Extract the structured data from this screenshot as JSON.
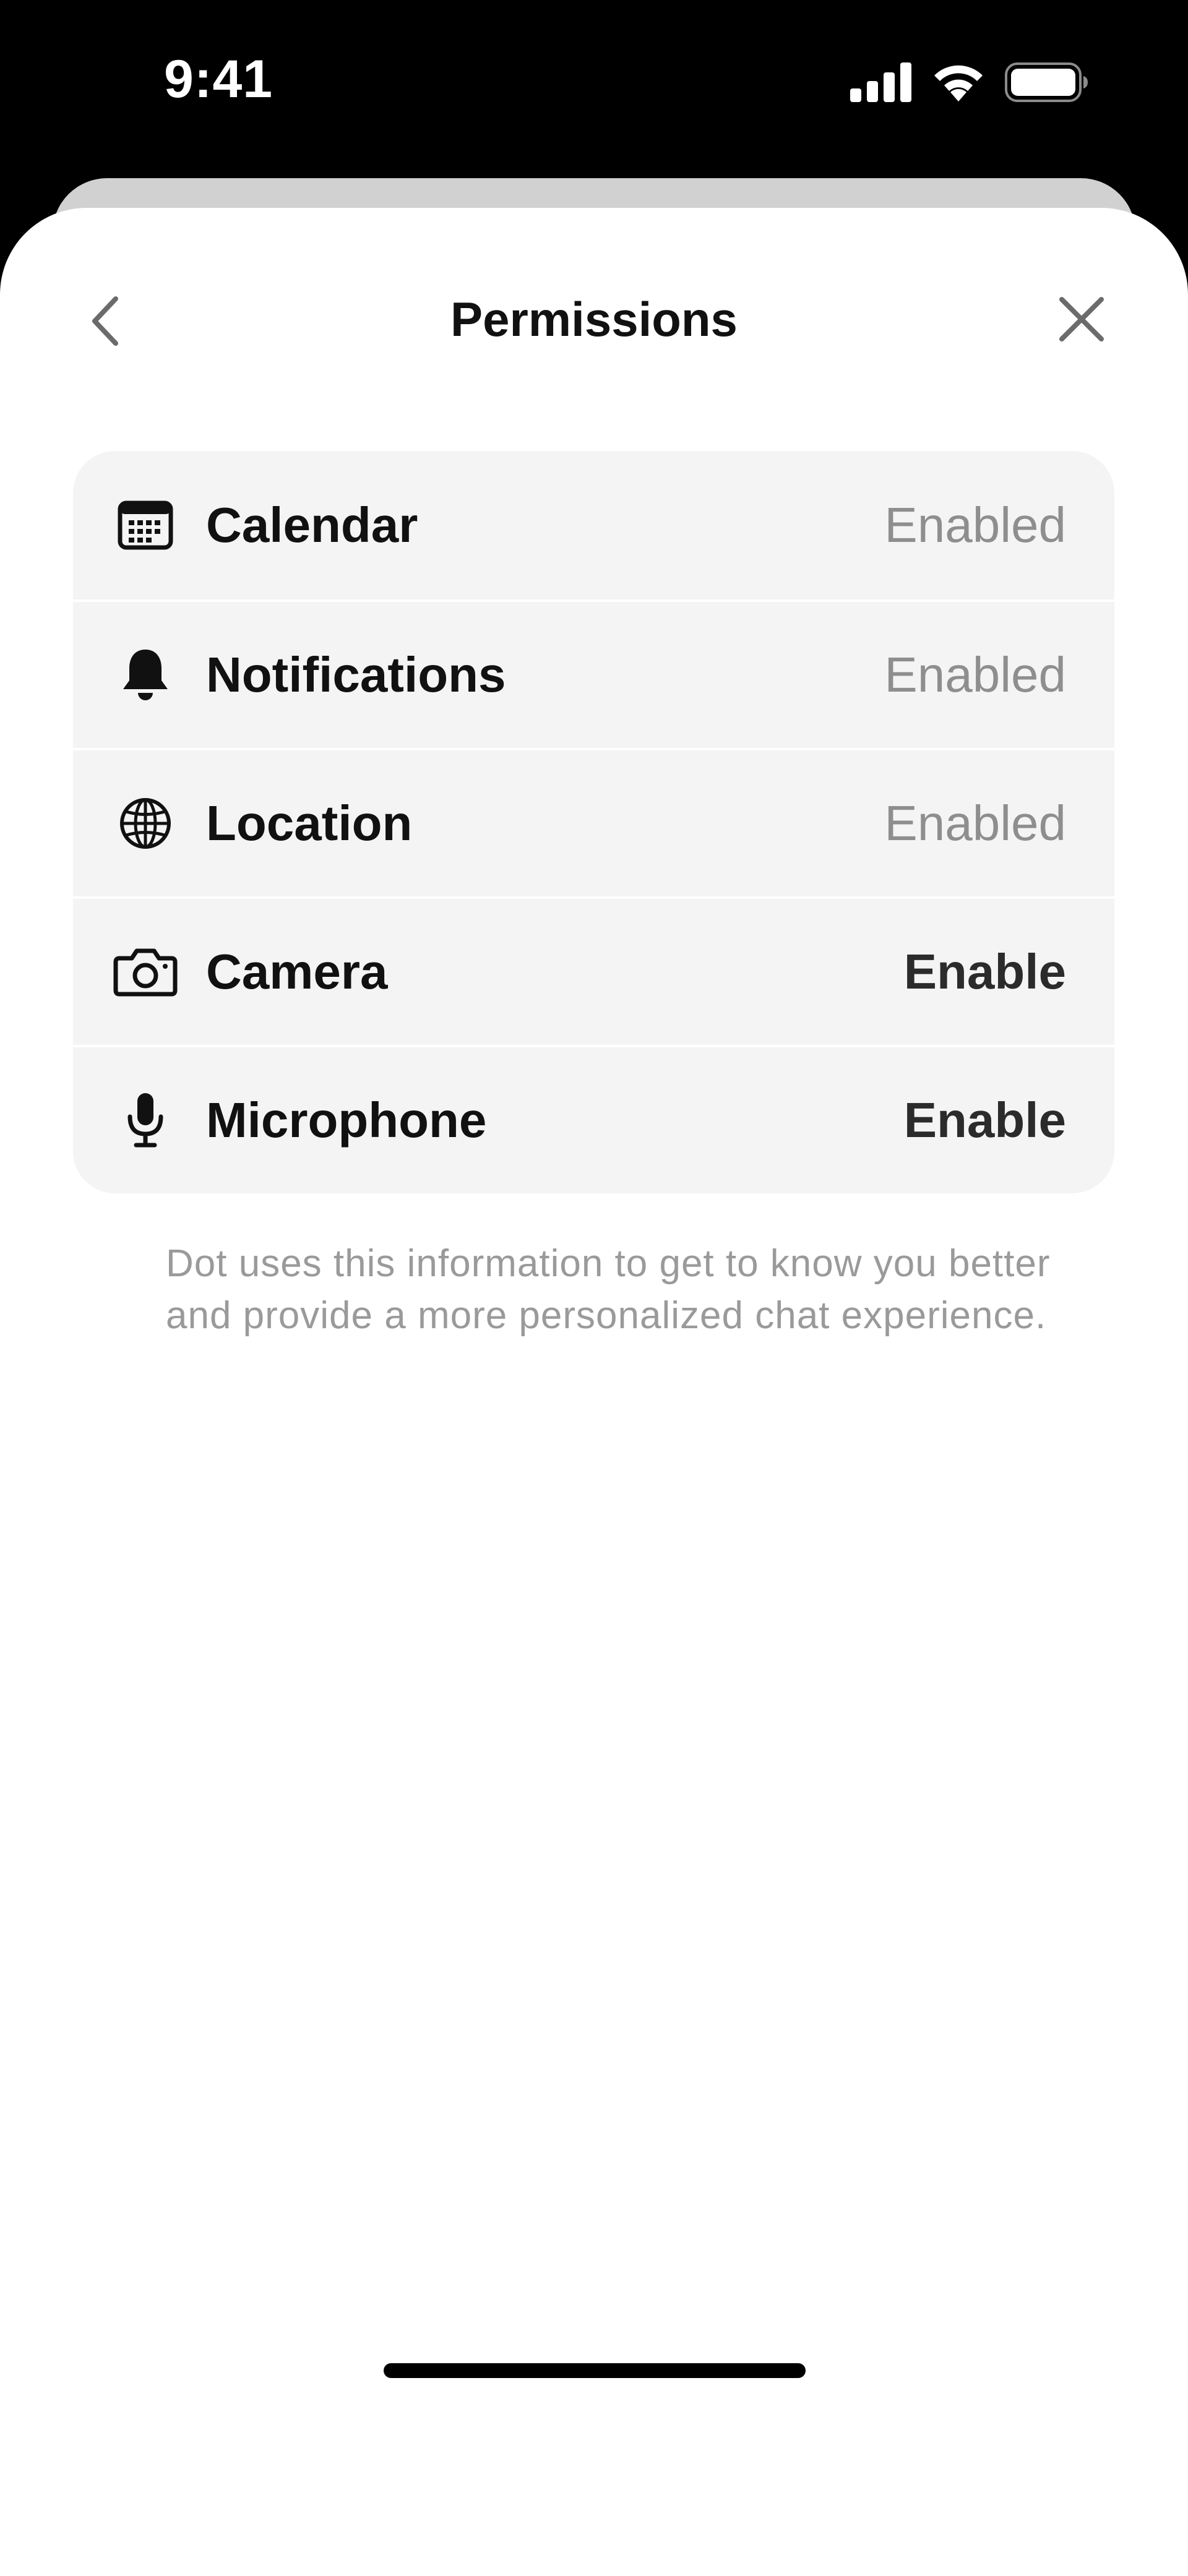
{
  "status_bar": {
    "time": "9:41",
    "icons": [
      "signal-icon",
      "wifi-icon",
      "battery-icon"
    ]
  },
  "header": {
    "title": "Permissions",
    "back_icon": "chevron-left-icon",
    "close_icon": "close-icon"
  },
  "permissions": [
    {
      "icon": "calendar-icon",
      "label": "Calendar",
      "status": "Enabled"
    },
    {
      "icon": "bell-icon",
      "label": "Notifications",
      "status": "Enabled"
    },
    {
      "icon": "globe-icon",
      "label": "Location",
      "status": "Enabled"
    },
    {
      "icon": "camera-icon",
      "label": "Camera",
      "status": "Enable"
    },
    {
      "icon": "microphone-icon",
      "label": "Microphone",
      "status": "Enable"
    }
  ],
  "footnote": "Dot uses this information to get to know you better and provide a more personalized chat experience.",
  "colors": {
    "sheet_background": "#ffffff",
    "list_background": "#f4f4f4",
    "status_enabled": "#8e8e8e",
    "status_enable": "#2b2b2b",
    "text_primary": "#111111",
    "footnote_text": "#9a9a9a"
  }
}
